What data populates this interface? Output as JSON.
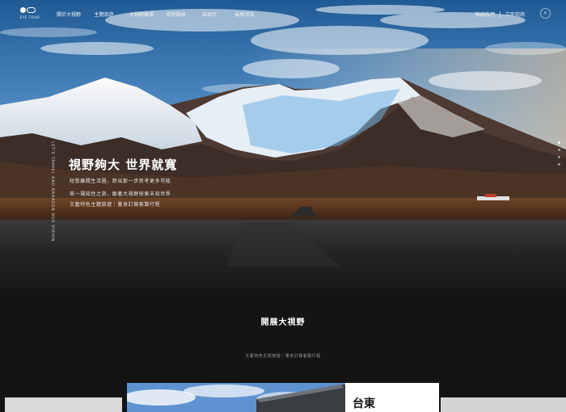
{
  "brand": {
    "logo_text": "EYE TOUR"
  },
  "nav": {
    "items": [
      "關於大視野",
      "主題旅遊",
      "大視野嚴選",
      "旅遊服務",
      "自由行",
      "最新消息"
    ],
    "right_links": [
      "聯絡我們",
      "立即諮詢"
    ],
    "search_icon": "search-icon"
  },
  "hero": {
    "vertical_text": "LET'S TRAVEL AND BROADEN OUR VISION",
    "title": "視野夠大 世界就寬",
    "lines": [
      "短暫離開生活圈，跨出那一步思考更多可能",
      "來一場知性之旅，跟著大視野探索未知世界",
      "文藝特色主題旅遊｜量身訂做客製行程"
    ],
    "slides": 4,
    "active_slide": 0
  },
  "section": {
    "title": "開展大視野",
    "subtitle": "文藝特色主題旅遊｜量身訂做客製行程"
  },
  "card": {
    "city": "台東"
  },
  "colors": {
    "background": "#141414",
    "text": "#ffffff",
    "card": "#ffffff"
  }
}
